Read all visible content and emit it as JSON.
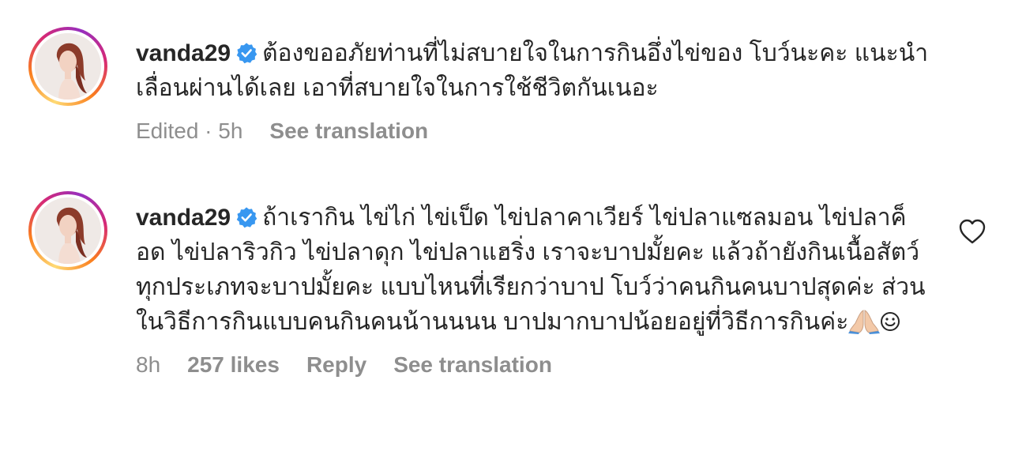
{
  "comments": [
    {
      "username": "vanda29",
      "verified": true,
      "text": "ต้องขออภัยท่านที่ไม่สบายใจในการกินอึ่งไข่ของ โบว์นะคะ แนะนำเลื่อนผ่านได้เลย เอาที่สบายใจในการใช้ชีวิตกันเนอะ",
      "meta": {
        "edited_time": "Edited · 5h",
        "see_translation": "See translation"
      }
    },
    {
      "username": "vanda29",
      "verified": true,
      "text": "ถ้าเรากิน ไข่ไก่ ไข่เป็ด ไข่ปลาคาเวียร์ ไข่ปลาแซลมอน ไข่ปลาค็อด ไข่ปลาริวกิว ไข่ปลาดุก ไข่ปลาแฮริ่ง เราจะบาปมั้ยคะ แล้วถ้ายังกินเนื้อสัตว์ทุกประเภทจะบาปมั้ยคะ แบบไหนที่เรียกว่าบาป โบว์ว่าคนกินคนบาปสุดค่ะ ส่วนในวิธีการกินแบบคนกินคนน้านนนน บาปมากบาปน้อยอยู่ที่วิธีการกินค่ะ",
      "emoji": [
        "folded-hands-icon",
        "smiling-face-icon"
      ],
      "meta": {
        "time": "8h",
        "likes": "257 likes",
        "reply": "Reply",
        "see_translation": "See translation"
      }
    }
  ],
  "colors": {
    "text": "#262626",
    "meta": "#8e8e8e",
    "verified": "#3897f0"
  }
}
